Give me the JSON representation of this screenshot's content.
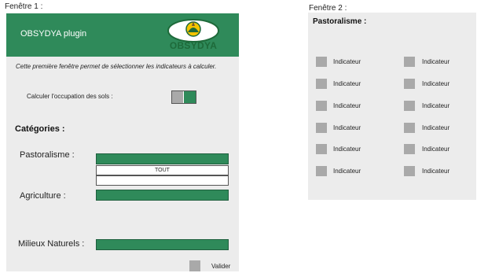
{
  "window1": {
    "label": "Fenêtre 1 :",
    "plugin_title": "OBSYDYA plugin",
    "logo_text": "OBSYDYA",
    "description": "Cette première fenêtre permet de sélectionner les indicateurs à calculer.",
    "occupation_label": "Calculer l'occupation des sols :",
    "categories_title": "Catégories :",
    "categories": [
      {
        "label": "Pastoralisme :"
      },
      {
        "label": "Agriculture :"
      },
      {
        "label": "Milieux Naturels :"
      }
    ],
    "dropdown_option": "TOUT",
    "validate_label": "Valider"
  },
  "window2": {
    "label": "Fenêtre 2 :",
    "title": "Pastoralisme :",
    "indicators_left": [
      "Indicateur",
      "Indicateur",
      "Indicateur",
      "Indicateur",
      "Indicateur",
      "Indicateur"
    ],
    "indicators_right": [
      "Indicateur",
      "Indicateur",
      "Indicateur",
      "Indicateur",
      "Indicateur",
      "Indicateur"
    ]
  },
  "colors": {
    "accent_green": "#2f8a5a",
    "panel_gray": "#ececec",
    "checkbox_gray": "#a9a9a9"
  }
}
